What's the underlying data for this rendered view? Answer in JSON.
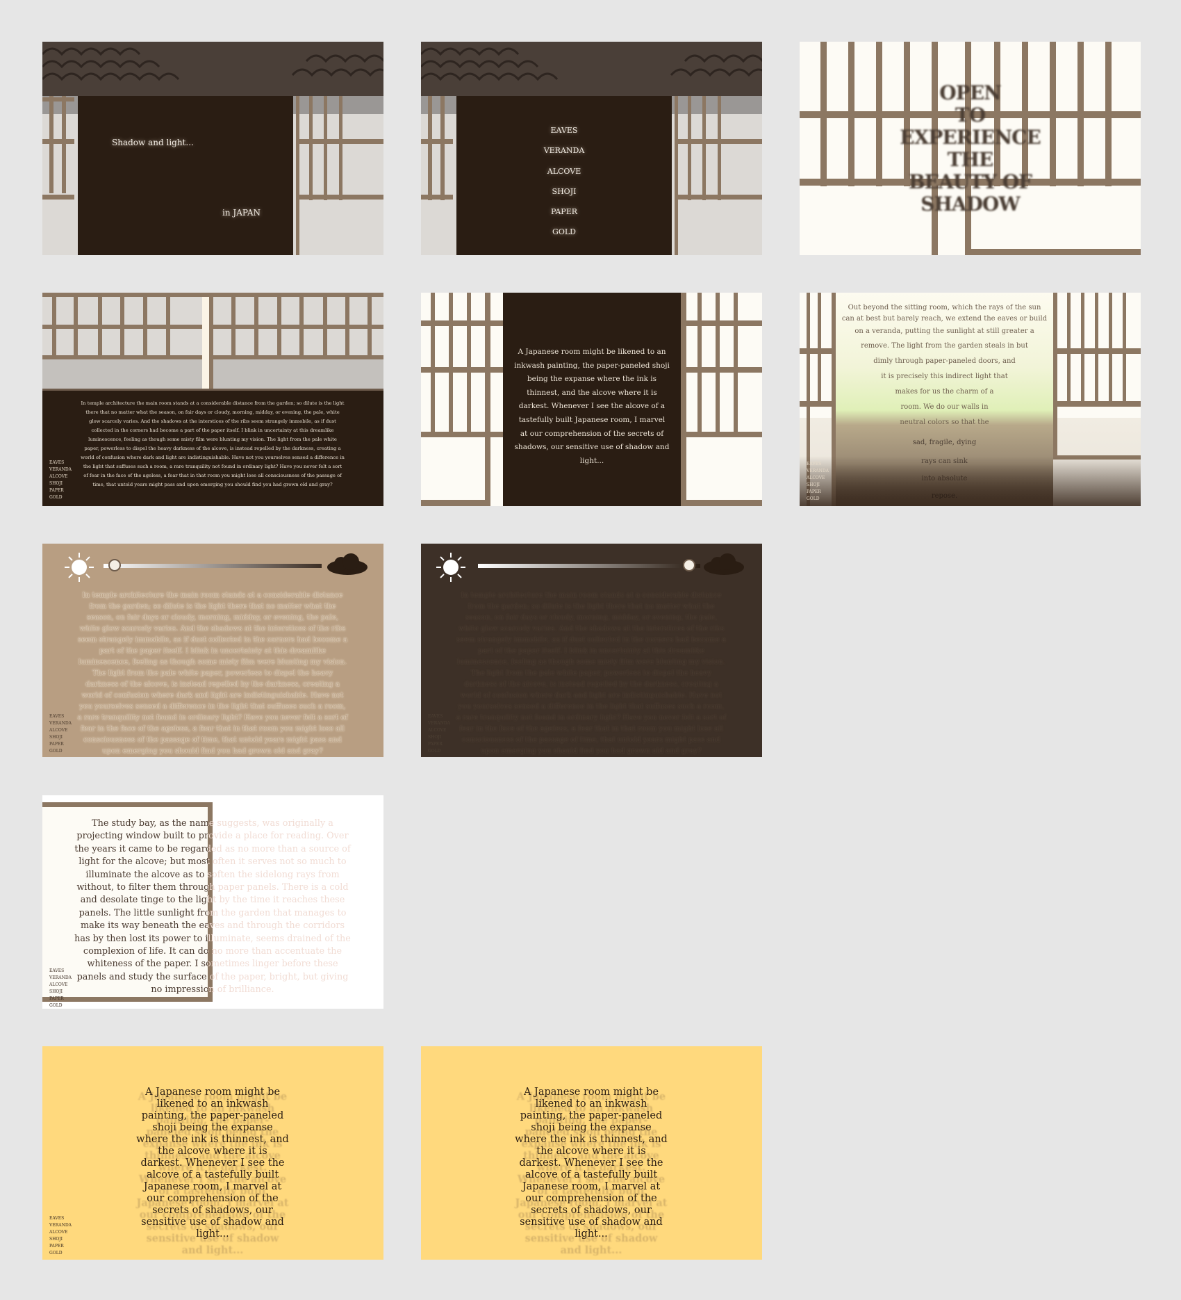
{
  "panels": {
    "intro": {
      "line1": "Shadow and light...",
      "line2": "in JAPAN"
    },
    "menu": {
      "items": [
        "EAVES",
        "VERANDA",
        "ALCOVE",
        "SHOJI",
        "PAPER",
        "GOLD"
      ]
    },
    "open": {
      "lines": [
        "OPEN",
        "TO",
        "EXPERIENCE",
        "THE",
        "BEAUTY OF",
        "SHADOW"
      ]
    },
    "temple_text": "In temple architecture the main room stands at a considerable distance from the garden; so dilute is the light there that no matter what the season, on fair days or cloudy, morning, midday, or evening, the pale, white glow scarcely varies. And the shadows at the interstices of the ribs seem strangely immobile, as if dust collected in the corners had become a part of the paper itself. I blink in uncertainty at this dreamlike luminescence, feeling as though some misty film were blunting my vision. The light from the pale white paper, powerless to dispel the heavy darkness of the alcove, is instead repelled by the darkness, creating a world of confusion where dark and light are indistinguishable. Have not you yourselves sensed a difference in the light that suffuses such a room, a rare tranquility not found in ordinary light? Have you never felt a sort of fear in the face of the ageless, a fear that in that room you might lose all consciousness of the passage of time, that untold years might pass and upon emerging you should find you had grown old and gray?",
    "room_text": "A Japanese room might be likened to an inkwash painting, the paper-paneled shoji being the expanse where the ink is thinnest, and the alcove where it is darkest. Whenever I see the alcove of a tastefully built Japanese room, I marvel at our comprehension of the secrets of shadows, our sensitive use of shadow and light...",
    "veranda_lines": [
      "Out beyond the sitting room, which the rays of the sun",
      "can at best but barely reach, we extend the eaves or build",
      "on a veranda, putting the sunlight at still greater a",
      "remove. The light from the garden steals in but",
      "dimly through paper-paneled doors, and",
      "it is precisely this indirect light that",
      "makes for us the charm of a",
      "room. We do our walls in",
      "neutral colors so that the"
    ],
    "veranda_fade_lines": [
      "sad, fragile, dying",
      "rays can sink",
      "into absolute",
      "repose."
    ],
    "study_text": "The study bay, as the name suggests, was originally a projecting window built to provide a place for reading. Over the years it came to be regarded as no more than a source of light for the alcove; but most often it serves not so much to illuminate the alcove as to soften the sidelong rays from without, to filter them through paper panels. There is a cold and desolate tinge to the light by the time it reaches these panels. The little sunlight from the garden that manages to make its way beneath the eaves and through the corridors has by then lost its power to illuminate, seems drained of the complexion of life. It can do no more than accentuate the whiteness of the paper. I sometimes linger before these panels and study the surface of the paper, bright, but giving no impression of brilliance.",
    "gold_text": "A Japanese room might be likened to an inkwash painting, the paper-paneled shoji being the expanse where the ink is thinnest, and the alcove where it is darkest. Whenever I see the alcove of a tastefully built Japanese room, I marvel at our comprehension of the secrets of shadows, our sensitive use of shadow and light...",
    "slider_light": {
      "level": 0.05
    },
    "slider_dark": {
      "level": 0.95
    }
  },
  "nav": [
    "EAVES",
    "VERANDA",
    "ALCOVE",
    "SHOJI",
    "PAPER",
    "GOLD"
  ],
  "icons": {
    "sun": "sun-icon",
    "cloud": "cloud-icon"
  },
  "colors": {
    "background": "#e6e6e6",
    "dark_brown": "#2a1d13",
    "frame": "#8c7762",
    "tan": "#b89e82",
    "gold": "#ffd97d",
    "paper": "#fdfbf5"
  }
}
